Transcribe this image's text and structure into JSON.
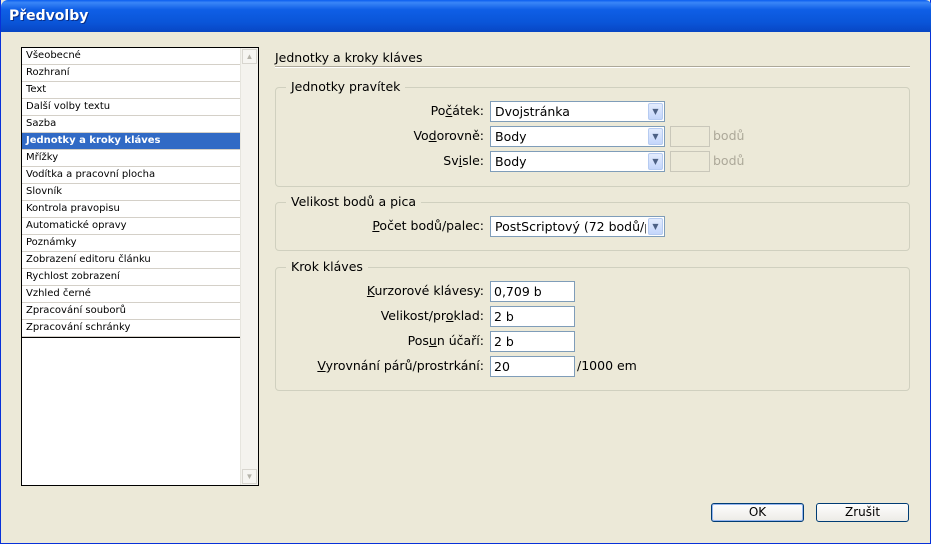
{
  "window": {
    "title": "Předvolby"
  },
  "sidebar": {
    "items": [
      {
        "label": "Všeobecné"
      },
      {
        "label": "Rozhraní"
      },
      {
        "label": "Text"
      },
      {
        "label": "Další volby textu"
      },
      {
        "label": "Sazba"
      },
      {
        "label": "Jednotky a kroky kláves",
        "selected": true
      },
      {
        "label": "Mřížky"
      },
      {
        "label": "Vodítka a pracovní plocha"
      },
      {
        "label": "Slovník"
      },
      {
        "label": "Kontrola pravopisu"
      },
      {
        "label": "Automatické opravy"
      },
      {
        "label": "Poznámky"
      },
      {
        "label": "Zobrazení editoru článku"
      },
      {
        "label": "Rychlost zobrazení"
      },
      {
        "label": "Vzhled černé"
      },
      {
        "label": "Zpracování souborů"
      },
      {
        "label": "Zpracování schránky"
      }
    ]
  },
  "panel": {
    "title": "Jednotky a kroky kláves",
    "ruler_units": {
      "legend": "Jednotky pravítek",
      "origin": {
        "label_pre": "Po",
        "label_key": "č",
        "label_post": "átek:",
        "value": "Dvojstránka"
      },
      "horizontal": {
        "label_pre": "Vo",
        "label_key": "d",
        "label_post": "orovně:",
        "value": "Body",
        "points_unit": "bodů"
      },
      "vertical": {
        "label_pre": "Sv",
        "label_key": "i",
        "label_post": "sle:",
        "value": "Body",
        "points_unit": "bodů"
      }
    },
    "point_pica": {
      "legend": "Velikost bodů a pica",
      "points_per_inch": {
        "label_pre": "",
        "label_key": "P",
        "label_post": "očet bodů/palec:",
        "value": "PostScriptový (72 bodů/palec)"
      }
    },
    "keyboard_increments": {
      "legend": "Krok kláves",
      "cursor_key": {
        "label_pre": "",
        "label_key": "K",
        "label_post": "urzorové klávesy:",
        "value": "0,709 b"
      },
      "size_leading": {
        "label_pre": "Velikost/pr",
        "label_key": "o",
        "label_post": "klad:",
        "value": "2 b"
      },
      "baseline_shift": {
        "label_pre": "Pos",
        "label_key": "u",
        "label_post": "n účaří:",
        "value": "2 b"
      },
      "kerning_tracking": {
        "label_pre": "",
        "label_key": "V",
        "label_post": "yrovnání párů/prostrkání:",
        "value": "20",
        "unit": "/1000 em"
      }
    }
  },
  "buttons": {
    "ok": "OK",
    "cancel": "Zrušit"
  },
  "colors": {
    "selection": "#316ac5",
    "titlebar": "#0a55d8",
    "dialog_bg": "#ece9d8"
  }
}
